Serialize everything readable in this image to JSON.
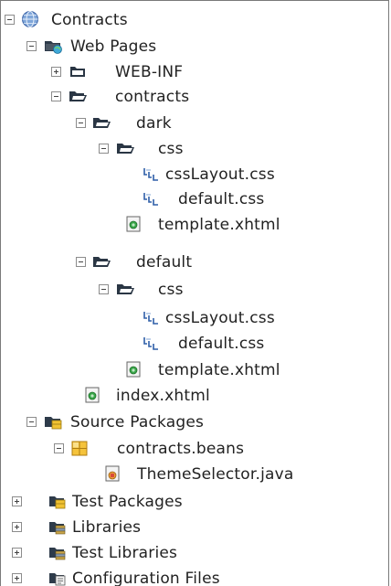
{
  "tree": {
    "nodes": [
      {
        "label": "Contracts",
        "icon": "globe-icon",
        "expanded": true
      },
      {
        "label": "Web Pages",
        "icon": "web-folder-icon",
        "expanded": true
      },
      {
        "label": "WEB-INF",
        "icon": "folder-icon",
        "expanded": false
      },
      {
        "label": "contracts",
        "icon": "folder-icon",
        "expanded": true
      },
      {
        "label": "dark",
        "icon": "folder-icon",
        "expanded": true
      },
      {
        "label": "css",
        "icon": "folder-icon",
        "expanded": true
      },
      {
        "label": "cssLayout.css",
        "icon": "css-file-icon"
      },
      {
        "label": "default.css",
        "icon": "css-file-icon"
      },
      {
        "label": "template.xhtml",
        "icon": "xhtml-file-icon"
      },
      {
        "label": "default",
        "icon": "folder-icon",
        "expanded": true
      },
      {
        "label": "css",
        "icon": "folder-icon",
        "expanded": true
      },
      {
        "label": "cssLayout.css",
        "icon": "css-file-icon"
      },
      {
        "label": "default.css",
        "icon": "css-file-icon"
      },
      {
        "label": "template.xhtml",
        "icon": "xhtml-file-icon"
      },
      {
        "label": "index.xhtml",
        "icon": "xhtml-file-icon"
      },
      {
        "label": "Source Packages",
        "icon": "source-packages-icon",
        "expanded": true
      },
      {
        "label": "contracts.beans",
        "icon": "package-icon",
        "expanded": true
      },
      {
        "label": "ThemeSelector.java",
        "icon": "java-file-icon"
      },
      {
        "label": "Test Packages",
        "icon": "test-packages-icon",
        "expanded": false
      },
      {
        "label": "Libraries",
        "icon": "libraries-icon",
        "expanded": false
      },
      {
        "label": "Test Libraries",
        "icon": "test-libraries-icon",
        "expanded": false
      },
      {
        "label": "Configuration Files",
        "icon": "configuration-files-icon",
        "expanded": false
      }
    ]
  }
}
